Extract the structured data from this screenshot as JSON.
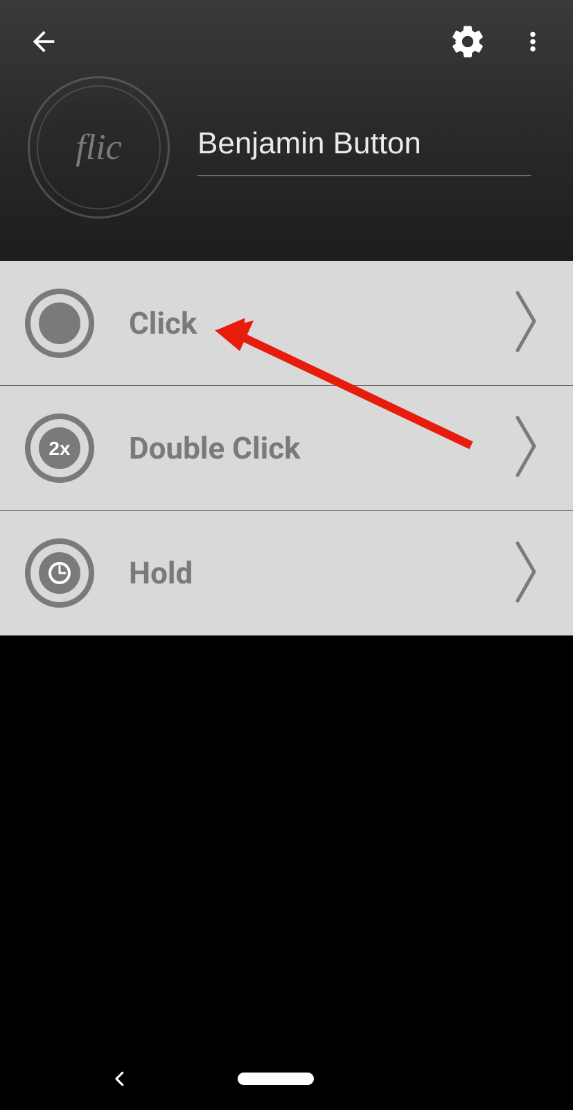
{
  "header": {
    "button_name": "Benjamin Button",
    "brand_logo_text": "flic"
  },
  "actions": [
    {
      "label": "Click",
      "icon": "single"
    },
    {
      "label": "Double Click",
      "icon": "double",
      "badge": "2x"
    },
    {
      "label": "Hold",
      "icon": "hold"
    }
  ],
  "colors": {
    "row_bg": "#d9d9d9",
    "icon_gray": "#7a7a7a",
    "label_gray": "#7a7a7a",
    "annotation_red": "#e81c0c"
  }
}
